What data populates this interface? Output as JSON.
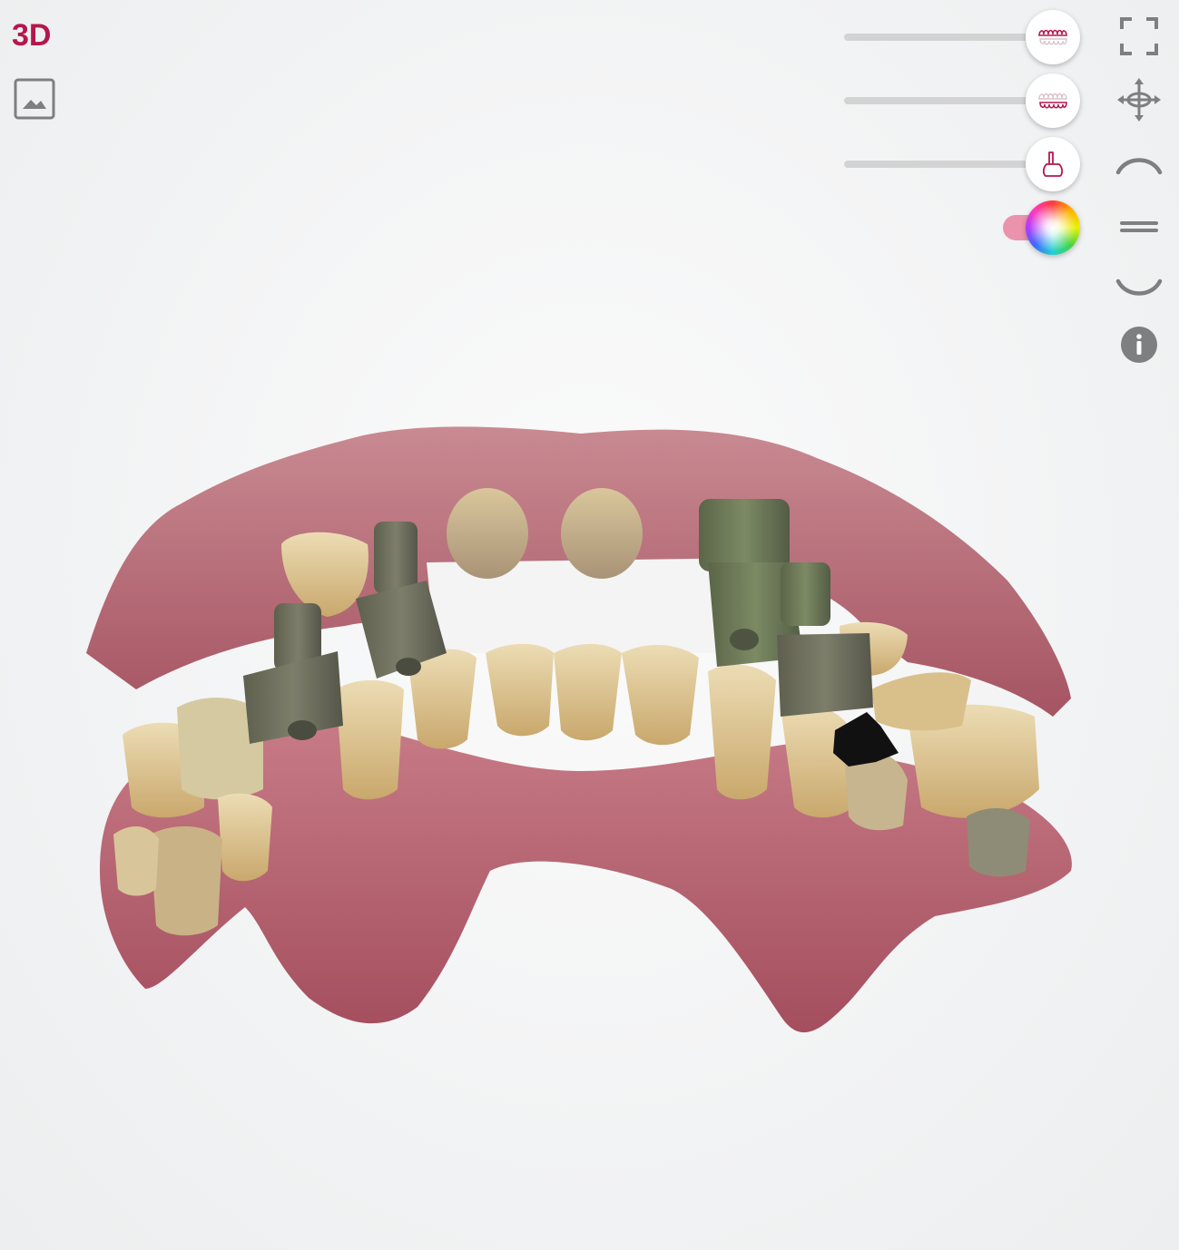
{
  "header": {
    "mode_label": "3D"
  },
  "colors": {
    "accent": "#b5174b",
    "toggle_on": "#eb93ad",
    "icon_gray": "#7d7f81",
    "slider_track": "#d3d3d4"
  },
  "sliders": [
    {
      "name": "upper-jaw-opacity",
      "icon": "upper-teeth-icon"
    },
    {
      "name": "lower-jaw-opacity",
      "icon": "lower-teeth-icon"
    },
    {
      "name": "scan-body-opacity",
      "icon": "implant-scanbody-icon"
    }
  ],
  "color_toggle": {
    "icon": "color-wheel-icon",
    "on": true
  },
  "toolbar": [
    {
      "name": "fullscreen-button",
      "icon": "fullscreen-icon"
    },
    {
      "name": "pan-button",
      "icon": "move-arrows-icon"
    },
    {
      "name": "upper-view-button",
      "icon": "arc-up-icon"
    },
    {
      "name": "occlusal-view-button",
      "icon": "double-line-icon"
    },
    {
      "name": "lower-view-button",
      "icon": "arc-down-icon"
    },
    {
      "name": "info-button",
      "icon": "info-icon"
    }
  ]
}
